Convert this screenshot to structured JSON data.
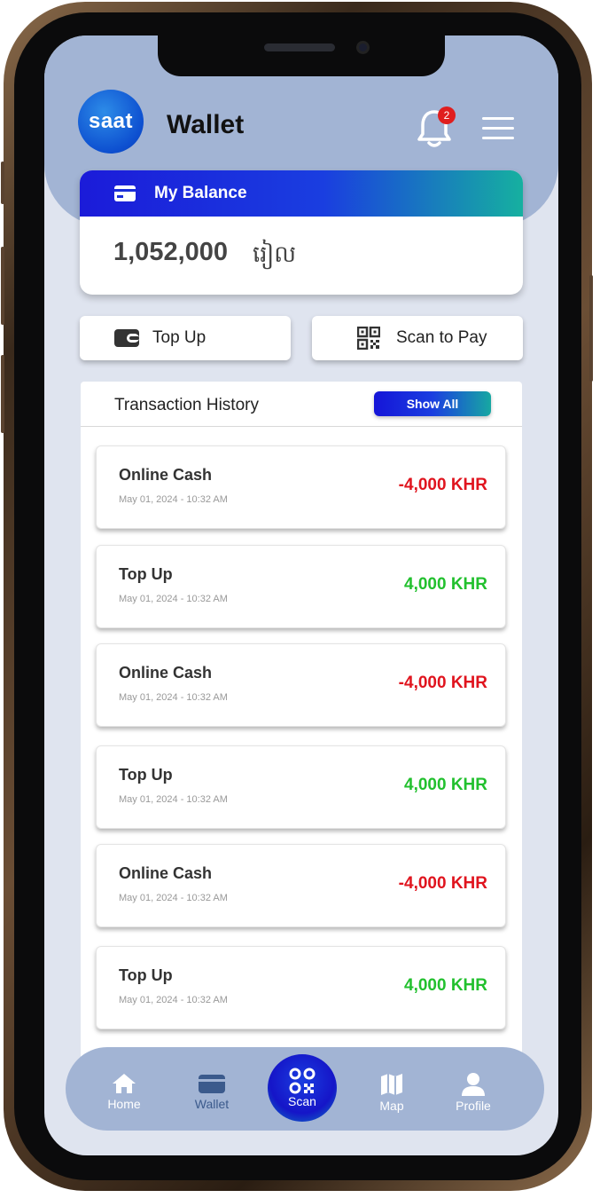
{
  "header": {
    "logo_text": "saat",
    "title": "Wallet",
    "notification_count": "2"
  },
  "balance": {
    "label": "My Balance",
    "amount": "1,052,000",
    "currency": "រៀល"
  },
  "actions": {
    "top_up": "Top Up",
    "scan_to_pay": "Scan to Pay"
  },
  "history": {
    "title": "Transaction History",
    "show_all": "Show All",
    "items": [
      {
        "name": "Online Cash",
        "date": "May 01, 2024 - 10:32 AM",
        "amount": "-4,000 KHR",
        "type": "debit"
      },
      {
        "name": "Top Up",
        "date": "May 01, 2024 - 10:32 AM",
        "amount": "4,000 KHR",
        "type": "credit"
      },
      {
        "name": "Online Cash",
        "date": "May 01, 2024 - 10:32 AM",
        "amount": "-4,000 KHR",
        "type": "debit"
      },
      {
        "name": "Top Up",
        "date": "May 01, 2024 - 10:32 AM",
        "amount": "4,000 KHR",
        "type": "credit"
      },
      {
        "name": "Online Cash",
        "date": "May 01, 2024 - 10:32 AM",
        "amount": "-4,000 KHR",
        "type": "debit"
      },
      {
        "name": "Top Up",
        "date": "May 01, 2024 - 10:32 AM",
        "amount": "4,000 KHR",
        "type": "credit"
      }
    ]
  },
  "nav": {
    "home": "Home",
    "wallet": "Wallet",
    "scan": "Scan",
    "map": "Map",
    "profile": "Profile"
  },
  "colors": {
    "debit": "#e0141e",
    "credit": "#22c02e",
    "header_bg": "#a2b4d4",
    "accent_blue": "#1a3ee0",
    "accent_teal": "#16b0a0",
    "active_nav": "#3b5a8c"
  },
  "icons": {
    "bell": "bell-icon",
    "menu": "hamburger-menu-icon",
    "card": "credit-card-icon",
    "wallet": "wallet-icon",
    "qr": "qr-code-icon",
    "home": "home-icon",
    "map": "map-icon",
    "profile": "user-icon"
  }
}
